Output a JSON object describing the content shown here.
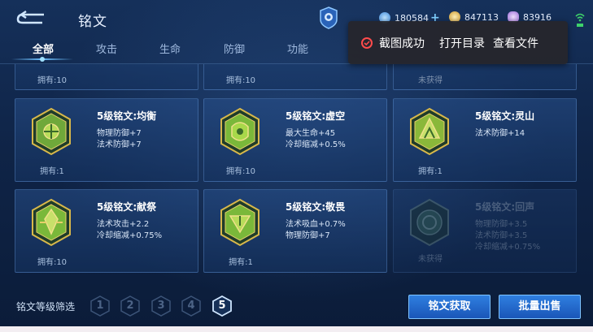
{
  "header": {
    "title": "铭文",
    "resources": [
      {
        "icon": "gem-coin-icon",
        "value": "180584",
        "color": "#6fb8ff"
      },
      {
        "icon": "gold-coin-icon",
        "value": "847113",
        "color": "#e0b84a"
      },
      {
        "icon": "purple-crystal-icon",
        "value": "83916",
        "color": "#c89aff"
      }
    ]
  },
  "tabs": [
    "全部",
    "攻击",
    "生命",
    "防御",
    "功能"
  ],
  "popup": {
    "status": "截图成功",
    "action_open_dir": "打开目录",
    "action_view_file": "查看文件"
  },
  "partial_row": [
    {
      "owned": "拥有:10"
    },
    {
      "owned": "拥有:10"
    },
    {
      "owned": "未获得"
    }
  ],
  "cards": [
    {
      "name": "5级铭文:均衡",
      "stats": [
        "物理防御+7",
        "法术防御+7"
      ],
      "owned": "拥有:1",
      "gem_color": "#c8a63a",
      "locked": false
    },
    {
      "name": "5级铭文:虚空",
      "stats": [
        "最大生命+45",
        "冷却缩减+0.5%"
      ],
      "owned": "拥有:10",
      "gem_color": "#9ac23a",
      "locked": false
    },
    {
      "name": "5级铭文:灵山",
      "stats": [
        "法术防御+14"
      ],
      "owned": "拥有:1",
      "gem_color": "#a8c43a",
      "locked": false
    },
    {
      "name": "5级铭文:献祭",
      "stats": [
        "法术攻击+2.2",
        "冷却缩减+0.75%"
      ],
      "owned": "拥有:10",
      "gem_color": "#b8c43a",
      "locked": false
    },
    {
      "name": "5级铭文:敬畏",
      "stats": [
        "法术吸血+0.7%",
        "物理防御+7"
      ],
      "owned": "拥有:1",
      "gem_color": "#a6c23a",
      "locked": false
    },
    {
      "name": "5级铭文:回声",
      "stats": [
        "物理防御+3.5",
        "法术防御+3.5",
        "冷却缩减+0.75%"
      ],
      "owned": "未获得",
      "gem_color": "#5a8a7a",
      "locked": true
    }
  ],
  "footer": {
    "filter_label": "铭文等级筛选",
    "levels": [
      "1",
      "2",
      "3",
      "4",
      "5"
    ],
    "active_level": "5",
    "btn_get": "铭文获取",
    "btn_sell": "批量出售"
  }
}
